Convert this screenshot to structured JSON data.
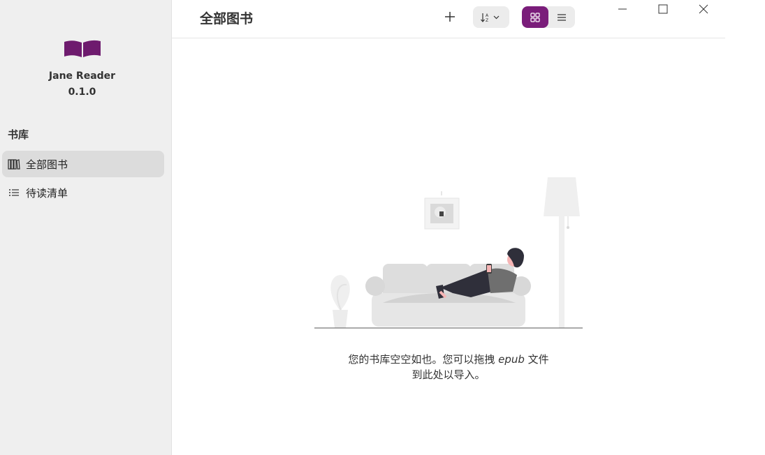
{
  "app": {
    "name": "Jane Reader",
    "version": "0.1.0"
  },
  "sidebar": {
    "section_title": "书库",
    "items": [
      {
        "label": "全部图书",
        "icon": "books-icon",
        "active": true
      },
      {
        "label": "待读清单",
        "icon": "list-icon",
        "active": false
      }
    ]
  },
  "header": {
    "title": "全部图书",
    "add_icon": "plus-icon",
    "sort_icon": "sort-icon",
    "view_modes": [
      "grid-view-icon",
      "list-view-icon"
    ],
    "active_view": "grid"
  },
  "window_controls": [
    "minimize-icon",
    "maximize-icon",
    "close-icon"
  ],
  "empty_state": {
    "line1_part1": "您的书库空空如也。您可以拖拽 ",
    "line1_part2": "epub",
    "line1_part3": " 文件",
    "line2": "到此处以导入。"
  },
  "colors": {
    "accent": "#7a1d7a",
    "sidebar_bg": "#efefef",
    "active_item_bg": "#dcdcdc"
  }
}
